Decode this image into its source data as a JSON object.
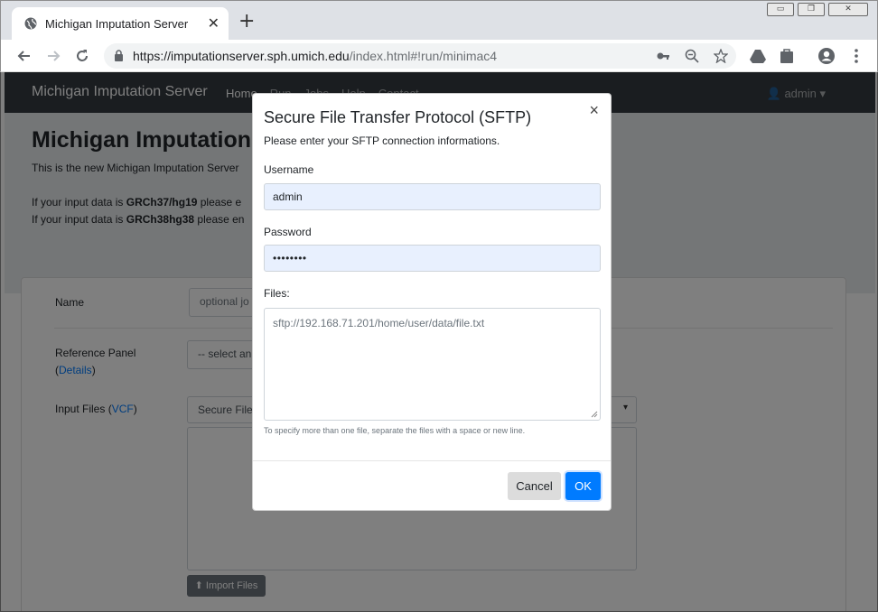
{
  "browser": {
    "tab_title": "Michigan Imputation Server",
    "tab_close": "✕",
    "new_tab": "+",
    "url_host": "https://imputationserver.sph.umich.edu",
    "url_rest": "/index.html#!run/minimac4"
  },
  "navbar": {
    "brand": "Michigan Imputation Server",
    "links": [
      "Home",
      "Run",
      "Jobs",
      "Help",
      "Contact"
    ],
    "user": "admin"
  },
  "jumbotron": {
    "title": "Michigan Imputation",
    "lead": "This is the new Michigan Imputation Server",
    "line1_prefix": "If your input data is ",
    "line1_bold": "GRCh37/hg19",
    "line1_suffix": " please e",
    "line2_prefix": "If your input data is ",
    "line2_bold": "GRCh38hg38",
    "line2_suffix": " please en"
  },
  "form": {
    "name_label": "Name",
    "name_placeholder": "optional jo",
    "ref_label": "Reference Panel",
    "ref_details_open": "(",
    "ref_details": "Details",
    "ref_details_close": ")",
    "ref_select": "-- select an",
    "input_label": "Input Files (",
    "input_vcf": "VCF",
    "input_close": ")",
    "input_select": "Secure File",
    "import_button": "Import Files"
  },
  "modal": {
    "title": "Secure File Transfer Protocol (SFTP)",
    "close": "×",
    "subtitle": "Please enter your SFTP connection informations.",
    "username_label": "Username",
    "username_value": "admin",
    "password_label": "Password",
    "password_value": "••••••••",
    "files_label": "Files:",
    "files_placeholder": "sftp://192.168.71.201/home/user/data/file.txt",
    "help": "To specify more than one file, separate the files with a space or new line.",
    "cancel": "Cancel",
    "ok": "OK"
  },
  "colors": {
    "primary": "#007bff",
    "navbar": "#343a40",
    "autofill": "#e8f0fe"
  }
}
